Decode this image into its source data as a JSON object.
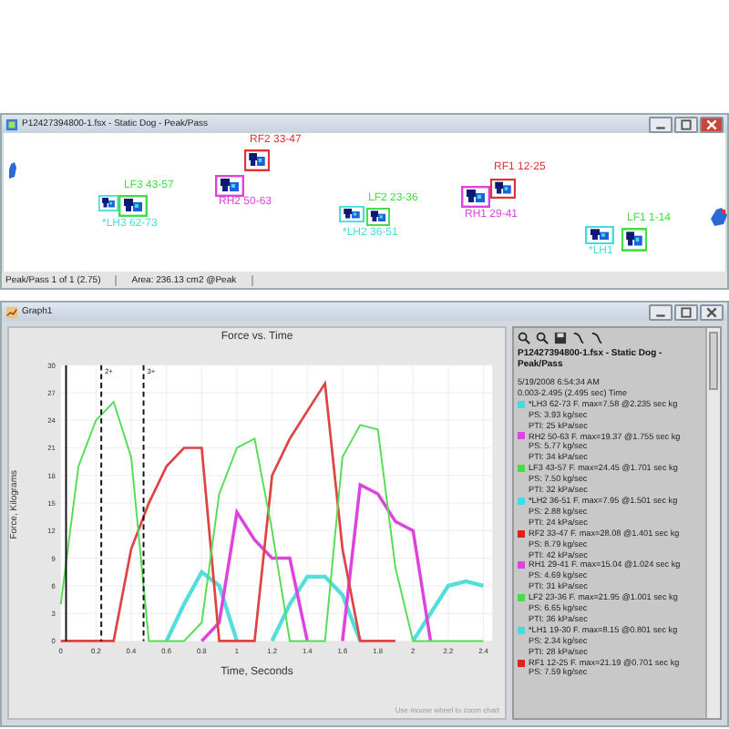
{
  "footprint_window": {
    "title": "P12427394800-1.fsx - Static Dog - Peak/Pass",
    "prints": [
      {
        "label": "RF2 33-47",
        "color": "#dd3333"
      },
      {
        "label": "RH2 50-63",
        "color": "#dd44dd"
      },
      {
        "label": "*LH3 62-73",
        "color": "#44dddd"
      },
      {
        "label": "LF3 43-57",
        "color": "#44dd44"
      },
      {
        "label": "*LH2 36-51",
        "color": "#44dddd"
      },
      {
        "label": "LF2 23-36",
        "color": "#44dd44"
      },
      {
        "label": "RH1 29-41",
        "color": "#dd44dd"
      },
      {
        "label": "RF1 12-25",
        "color": "#dd3333"
      },
      {
        "label": "*LH1",
        "color": "#44dddd"
      },
      {
        "label": "LF1 1-14",
        "color": "#44dd44"
      }
    ],
    "status_bar": [
      "Peak/Pass 1 of 1 (2.75)",
      "Area: 236.13 cm2 @Peak"
    ]
  },
  "graph_window": {
    "title": "Graph1",
    "chart_data": {
      "type": "line",
      "title": "Force vs. Time",
      "xlabel": "Time, Seconds",
      "ylabel": "Force, Kilograms",
      "x": [
        0,
        0.1,
        0.2,
        0.3,
        0.4,
        0.5,
        0.6,
        0.7,
        0.8,
        0.9,
        1.0,
        1.1,
        1.2,
        1.3,
        1.4,
        1.5,
        1.6,
        1.7,
        1.8,
        1.9,
        2.0,
        2.1,
        2.2,
        2.3,
        2.4
      ],
      "xlim": [
        0,
        2.45
      ],
      "ylim": [
        0,
        30
      ],
      "grid": true,
      "xticks": [
        {
          "value": 0,
          "label": "0"
        },
        {
          "value": 0.2,
          "label": "0.2"
        },
        {
          "value": 0.4,
          "label": "0.4"
        },
        {
          "value": 0.6,
          "label": "0.6"
        },
        {
          "value": 0.8,
          "label": "0.8"
        },
        {
          "value": 1,
          "label": "1"
        },
        {
          "value": 1.2,
          "label": "1.2"
        },
        {
          "value": 1.4,
          "label": "1.4"
        },
        {
          "value": 1.6,
          "label": "1.6"
        },
        {
          "value": 1.8,
          "label": "1.8"
        },
        {
          "value": 2,
          "label": "2"
        },
        {
          "value": 2.2,
          "label": "2.2"
        },
        {
          "value": 2.4,
          "label": "2.4"
        }
      ],
      "yticks": [
        0,
        3,
        6,
        9,
        12,
        15,
        18,
        21,
        24,
        27,
        30
      ],
      "series": [
        {
          "color": "#55dddd",
          "values": [
            null,
            null,
            null,
            null,
            null,
            null,
            0,
            4,
            7.5,
            6,
            0,
            null,
            0,
            4,
            7,
            7,
            5,
            0,
            null,
            null,
            0,
            3,
            6,
            6.5,
            6
          ]
        },
        {
          "color": "#dd44dd",
          "values": [
            null,
            null,
            null,
            null,
            null,
            null,
            null,
            null,
            0,
            2,
            14,
            11,
            9,
            9,
            0,
            null,
            0,
            17,
            16,
            13,
            12,
            0,
            null,
            null,
            null
          ]
        },
        {
          "color": "#dd4444",
          "values": [
            0,
            0,
            0,
            0,
            10,
            15,
            19,
            21,
            21,
            0,
            0,
            0,
            18,
            22,
            25,
            28,
            10,
            0,
            0,
            0,
            null,
            null,
            null,
            null,
            null
          ]
        },
        {
          "color": "#55dd55",
          "values": [
            4,
            19,
            24,
            26,
            20,
            0,
            0,
            0,
            2,
            16,
            21,
            22,
            12,
            0,
            0,
            0,
            20,
            23.5,
            23,
            8,
            0,
            0,
            0,
            0,
            0
          ]
        }
      ],
      "ref_lines": [
        {
          "axis": "x",
          "value": 0.03
        },
        {
          "axis": "x",
          "value": 0.23
        },
        {
          "axis": "x",
          "value": 0.47
        }
      ]
    },
    "cursor_tags": [
      "2+",
      "3+"
    ],
    "hint": "Use mouse wheel to zoom chart",
    "panel": {
      "title": "P12427394800-1.fsx - Static Dog - Peak/Pass",
      "date": "5/19/2008 6:54:34 AM",
      "range": "0.003-2.495 (2.495 sec) Time",
      "entries": [
        {
          "color": "#44dddd",
          "lines": [
            "*LH3 62-73 F. max=7.58 @2.235 sec kg",
            "PS: 3.93 kg/sec",
            "PTI: 25 kPa/sec"
          ]
        },
        {
          "color": "#dd44dd",
          "lines": [
            "RH2 50-63 F. max=19.37 @1.755 sec kg",
            "PS: 5.77 kg/sec",
            "PTI: 34 kPa/sec"
          ]
        },
        {
          "color": "#44dd44",
          "lines": [
            "LF3 43-57 F. max=24.45 @1.701 sec kg",
            "PS: 7.50 kg/sec",
            "PTI: 32 kPa/sec"
          ]
        },
        {
          "color": "#44dddd",
          "lines": [
            "*LH2 36-51 F. max=7.95 @1.501 sec kg",
            "PS: 2.88 kg/sec",
            "PTI: 24 kPa/sec"
          ]
        },
        {
          "color": "#dd2222",
          "lines": [
            "RF2 33-47 F. max=28.08 @1.401 sec kg",
            "PS: 8.79 kg/sec",
            "PTI: 42 kPa/sec"
          ]
        },
        {
          "color": "#dd44dd",
          "lines": [
            "RH1 29-41 F. max=15.04 @1.024 sec kg",
            "PS: 4.69 kg/sec",
            "PTI: 31 kPa/sec"
          ]
        },
        {
          "color": "#44dd44",
          "lines": [
            "LF2 23-36 F. max=21.95 @1.001 sec kg",
            "PS: 6.65 kg/sec",
            "PTI: 36 kPa/sec"
          ]
        },
        {
          "color": "#44dddd",
          "lines": [
            "*LH1 19-30 F. max=8.15 @0.801 sec kg",
            "PS: 2.34 kg/sec",
            "PTI: 28 kPa/sec"
          ]
        },
        {
          "color": "#dd2222",
          "lines": [
            "RF1 12-25 F. max=21.19 @0.701 sec kg",
            "PS: 7.59 kg/sec"
          ]
        }
      ]
    }
  }
}
